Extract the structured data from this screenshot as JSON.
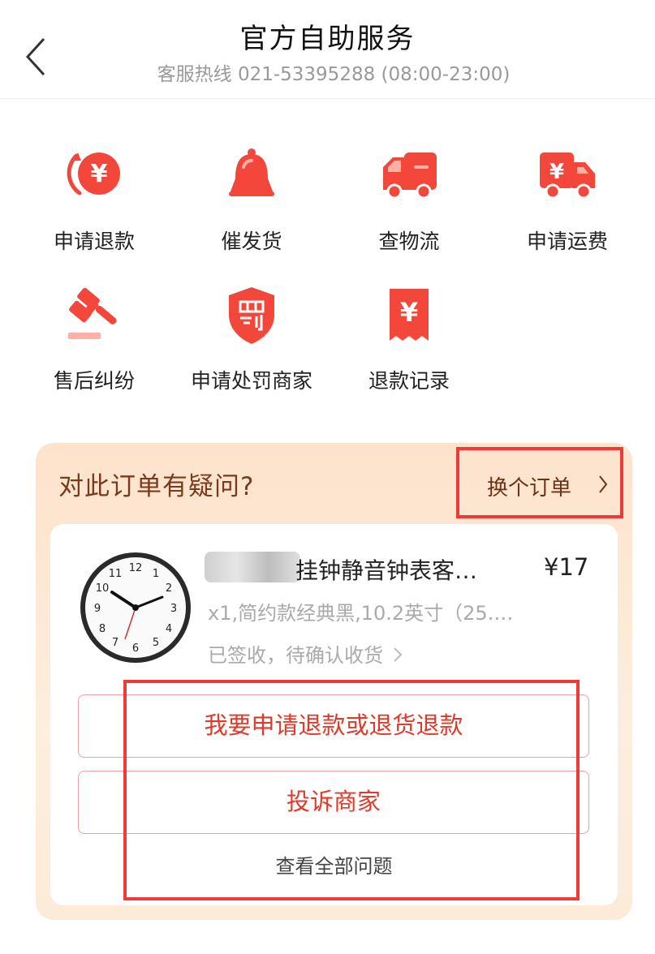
{
  "header": {
    "title": "官方自助服务",
    "subtitle": "客服热线 021-53395288 (08:00-23:00)"
  },
  "services": [
    {
      "label": "申请退款",
      "icon": "refund-yen-icon"
    },
    {
      "label": "催发货",
      "icon": "bell-icon"
    },
    {
      "label": "查物流",
      "icon": "truck-icon"
    },
    {
      "label": "申请运费",
      "icon": "shipping-fee-truck-icon"
    },
    {
      "label": "售后纠纷",
      "icon": "gavel-icon"
    },
    {
      "label": "申请处罚商家",
      "icon": "penalty-shield-icon"
    },
    {
      "label": "退款记录",
      "icon": "refund-receipt-icon"
    }
  ],
  "order": {
    "question": "对此订单有疑问?",
    "switch_label": "换个订单",
    "product": {
      "title": "挂钟静音钟表客…",
      "price": "¥17",
      "spec": "x1,简约款经典黑,10.2英寸（25.…",
      "status": "已签收，待确认收货",
      "clock_numbers": [
        "12",
        "1",
        "2",
        "3",
        "4",
        "5",
        "6",
        "7",
        "8",
        "9",
        "10",
        "11"
      ]
    },
    "refund_button": "我要申请退款或退货退款",
    "complain_button": "投诉商家",
    "all_questions": "查看全部问题"
  },
  "colors": {
    "accent": "#e03a2a",
    "icon_red": "#f2473a",
    "card_bg": "#fde8d4",
    "highlight": "#ef3a3a"
  }
}
